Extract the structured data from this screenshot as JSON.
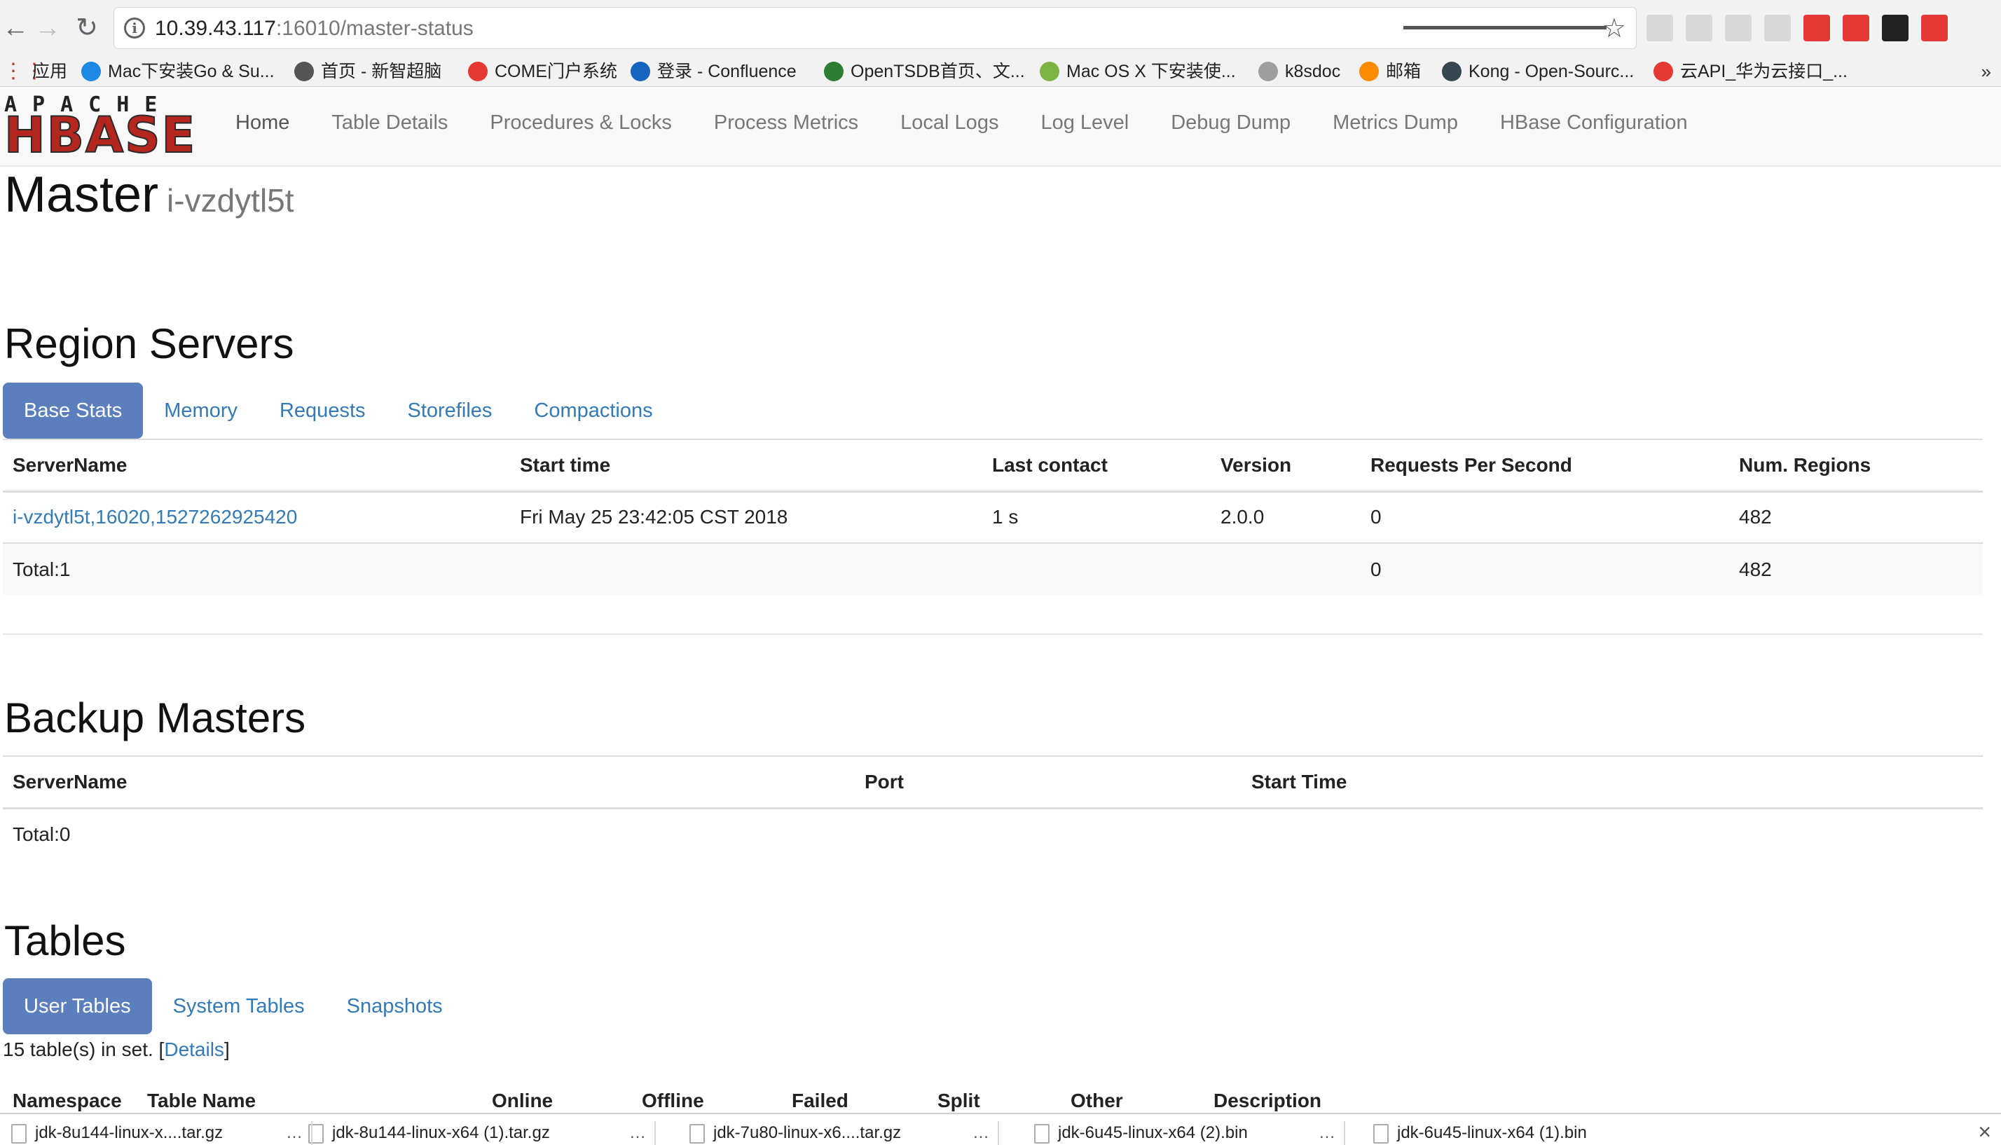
{
  "browser": {
    "url_host": "10.39.43.117",
    "url_path": ":16010/master-status",
    "bookmarks": [
      {
        "label": "应用",
        "color": "#c0392b"
      },
      {
        "label": "Mac下安装Go & Su...",
        "color": "#1e88e5"
      },
      {
        "label": "首页 - 新智超脑",
        "color": "#555555"
      },
      {
        "label": "COME门户系统",
        "color": "#e53935"
      },
      {
        "label": "登录 - Confluence",
        "color": "#1565c0"
      },
      {
        "label": "OpenTSDB首页、文...",
        "color": "#2e7d32"
      },
      {
        "label": "Mac OS X 下安装使...",
        "color": "#7cb342"
      },
      {
        "label": "k8sdoc",
        "color": "#9e9e9e"
      },
      {
        "label": "邮箱",
        "color": "#fb8c00"
      },
      {
        "label": "Kong - Open-Sourc...",
        "color": "#37474f"
      },
      {
        "label": "云API_华为云接口_...",
        "color": "#e53935"
      }
    ],
    "bookmarks_more": "»"
  },
  "nav": {
    "logo_top": "APACHE",
    "logo_main": "HBASE",
    "links": [
      "Home",
      "Table Details",
      "Procedures & Locks",
      "Process Metrics",
      "Local Logs",
      "Log Level",
      "Debug Dump",
      "Metrics Dump",
      "HBase Configuration"
    ]
  },
  "page": {
    "title": "Master",
    "host": "i-vzdytl5t"
  },
  "region_servers": {
    "heading": "Region Servers",
    "tabs": [
      "Base Stats",
      "Memory",
      "Requests",
      "Storefiles",
      "Compactions"
    ],
    "active_tab": 0,
    "columns": [
      "ServerName",
      "Start time",
      "Last contact",
      "Version",
      "Requests Per Second",
      "Num. Regions"
    ],
    "rows": [
      [
        "i-vzdytl5t,16020,1527262925420",
        "Fri May 25 23:42:05 CST 2018",
        "1 s",
        "2.0.0",
        "0",
        "482"
      ]
    ],
    "total": {
      "label": "Total:1",
      "requests": "0",
      "regions": "482"
    }
  },
  "backup_masters": {
    "heading": "Backup Masters",
    "columns": [
      "ServerName",
      "Port",
      "Start Time"
    ],
    "total": "Total:0"
  },
  "tables": {
    "heading": "Tables",
    "tabs": [
      "User Tables",
      "System Tables",
      "Snapshots"
    ],
    "active_tab": 0,
    "note_prefix": "15 table(s) in set. [",
    "note_link": "Details",
    "note_suffix": "]",
    "columns": [
      "Namespace",
      "Table Name",
      "Online",
      "Offline",
      "Failed",
      "Split",
      "Other",
      "Description"
    ]
  },
  "downloads": {
    "items": [
      "jdk-8u144-linux-x....tar.gz",
      "jdk-8u144-linux-x64 (1).tar.gz",
      "jdk-7u80-linux-x6....tar.gz",
      "jdk-6u45-linux-x64 (2).bin",
      "jdk-6u45-linux-x64 (1).bin"
    ],
    "more": "…",
    "close": "×"
  },
  "colors": {
    "link": "#337ab7",
    "active_tab": "#5b7fbd",
    "logo_red": "#b5261e"
  }
}
